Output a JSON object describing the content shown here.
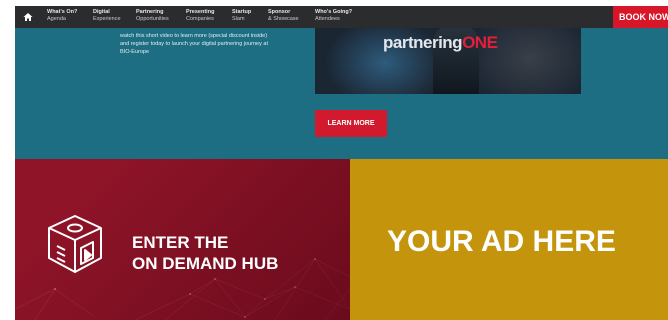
{
  "nav": {
    "items": [
      {
        "title": "What's On?",
        "sub": "Agenda"
      },
      {
        "title": "Digital",
        "sub": "Experience"
      },
      {
        "title": "Partnering",
        "sub": "Opportunities"
      },
      {
        "title": "Presenting",
        "sub": "Companies"
      },
      {
        "title": "Startup",
        "sub": "Slam"
      },
      {
        "title": "Sponsor",
        "sub": "& Showcase"
      },
      {
        "title": "Who's Going?",
        "sub": "Attendees"
      }
    ],
    "book_label": "BOOK NOW",
    "home_icon": "home-icon"
  },
  "hero": {
    "text_lines": [
      "watch this short video to learn more (special discount inside)",
      "and register today to launch your digital partnering journey at",
      "BIO-Europe"
    ],
    "video_logo_part1": "partnering",
    "video_logo_part2": "ONE",
    "learn_more_label": "LEARN MORE"
  },
  "hub_banner": {
    "line1": "ENTER THE",
    "line2": "ON DEMAND HUB",
    "icon": "on-demand-hub-icon"
  },
  "ad": {
    "label": "YOUR AD HERE"
  },
  "colors": {
    "nav_bg": "#2b2c2e",
    "book_bg": "#d8162a",
    "hero_bg": "#1d6e83",
    "learn_bg": "#d11a2e",
    "hub_bg": "#8f1428",
    "ad_bg": "#c4940c"
  }
}
